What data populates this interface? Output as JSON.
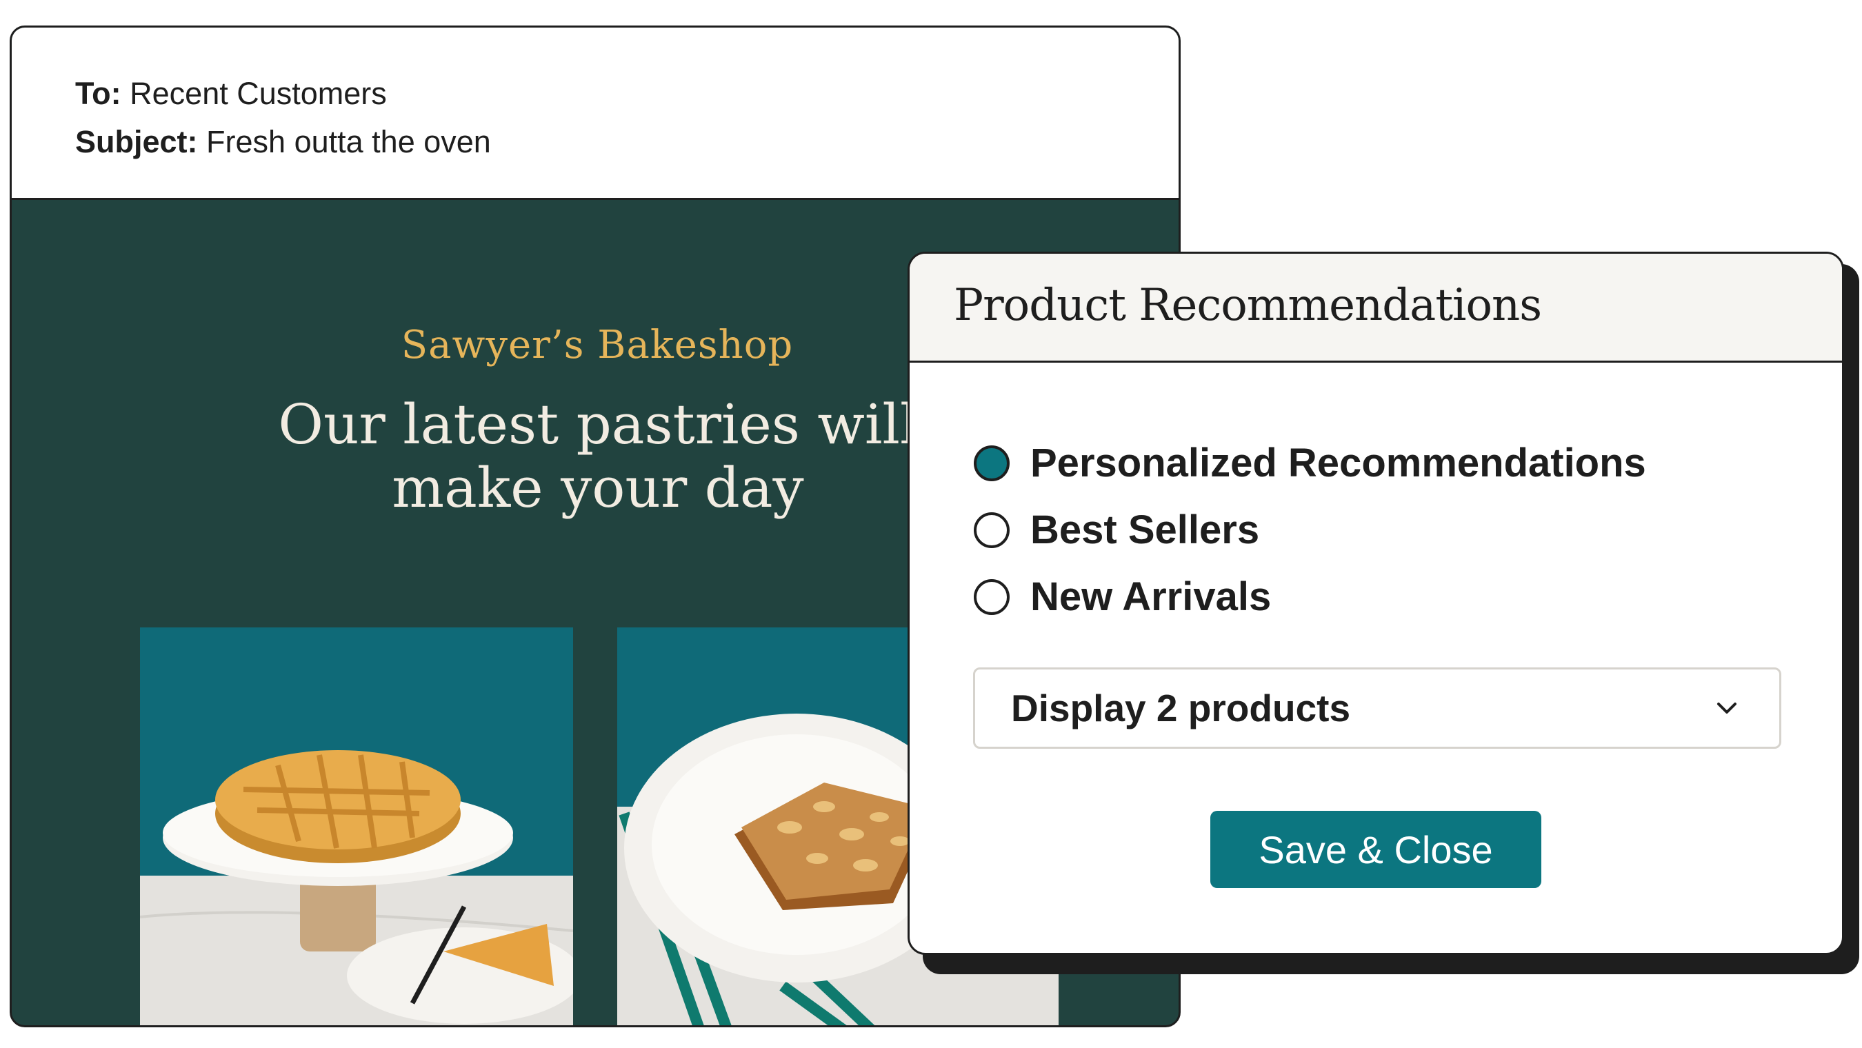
{
  "email": {
    "to_label": "To:",
    "to_value": "Recent Customers",
    "subject_label": "Subject:",
    "subject_value": "Fresh outta the oven",
    "brand": "Sawyer’s Bakeshop",
    "headline_line1": "Our latest pastries will",
    "headline_line2": "make your day"
  },
  "panel": {
    "title": "Product Recommendations",
    "options": [
      {
        "label": "Personalized Recommendations",
        "selected": true
      },
      {
        "label": "Best Sellers",
        "selected": false
      },
      {
        "label": "New Arrivals",
        "selected": false
      }
    ],
    "select_value": "Display 2 products",
    "save_label": "Save & Close"
  },
  "colors": {
    "email_bg": "#21433f",
    "brand": "#e6b55a",
    "accent": "#0c7680"
  }
}
